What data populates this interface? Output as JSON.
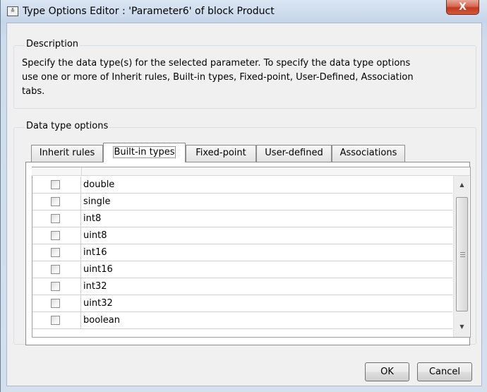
{
  "window": {
    "title": "Type Options Editor : 'Parameter6' of block Product",
    "close_glyph": "X",
    "app_icon": "matlab-block-icon"
  },
  "description": {
    "legend": "Description",
    "lines": [
      "Specify the data type(s) for the selected parameter. To specify the data type options",
      "use one or more of Inherit rules, Built-in types, Fixed-point, User-Defined, Association",
      "tabs."
    ]
  },
  "options": {
    "legend": "Data type options",
    "tabs": [
      {
        "label": "Inherit rules",
        "active": false
      },
      {
        "label": "Built-in types",
        "active": true
      },
      {
        "label": "Fixed-point",
        "active": false
      },
      {
        "label": "User-defined",
        "active": false
      },
      {
        "label": "Associations",
        "active": false
      }
    ],
    "types": [
      {
        "name": "double",
        "checked": false
      },
      {
        "name": "single",
        "checked": false
      },
      {
        "name": "int8",
        "checked": false
      },
      {
        "name": "uint8",
        "checked": false
      },
      {
        "name": "int16",
        "checked": false
      },
      {
        "name": "uint16",
        "checked": false
      },
      {
        "name": "int32",
        "checked": false
      },
      {
        "name": "uint32",
        "checked": false
      },
      {
        "name": "boolean",
        "checked": false
      }
    ]
  },
  "buttons": {
    "ok": "OK",
    "cancel": "Cancel"
  },
  "colors": {
    "title_bar": "#c6d6ea",
    "close_button": "#c2381e",
    "dialog_background": "#f0f0f0"
  }
}
